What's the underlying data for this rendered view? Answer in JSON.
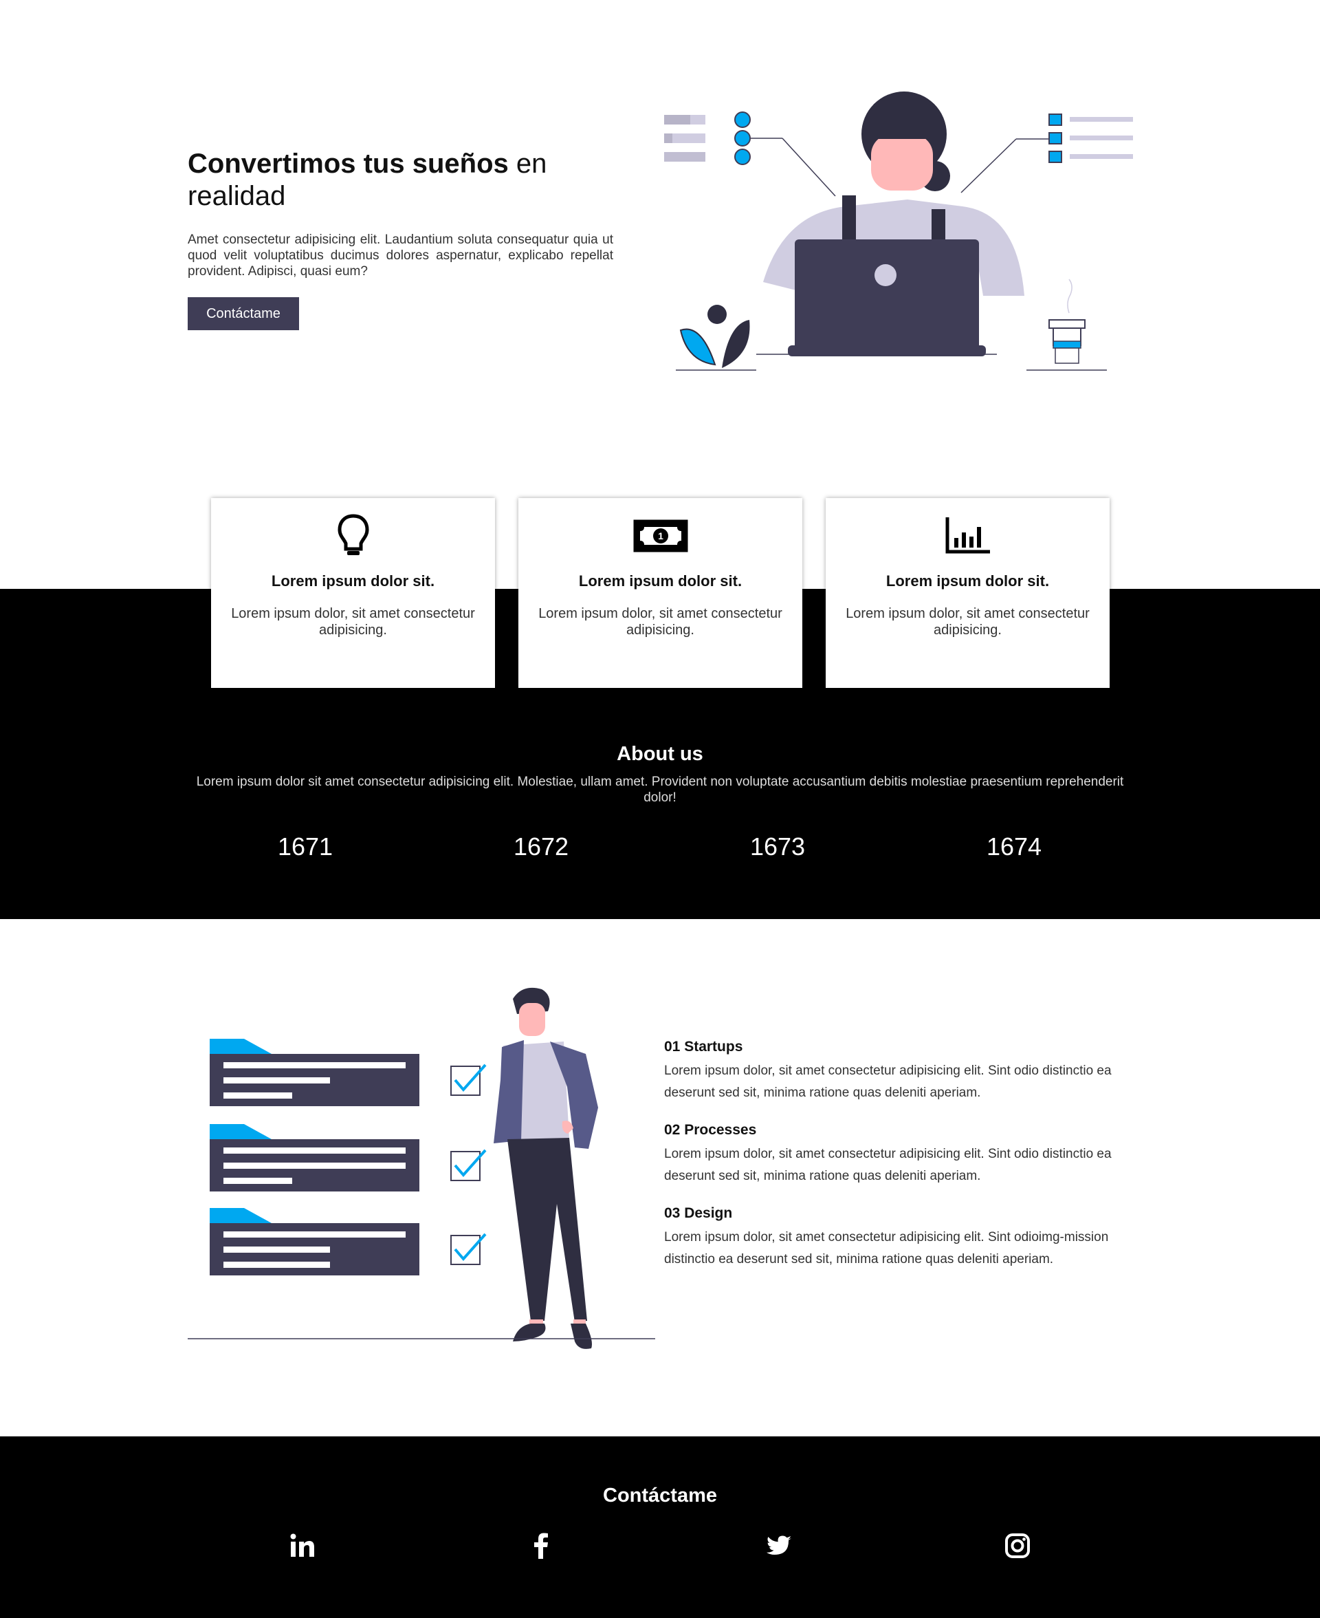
{
  "hero": {
    "title_bold": "Convertimos tus sueños",
    "title_rest": " en realidad",
    "description": "Amet consectetur adipisicing elit. Laudantium soluta consequatur quia ut quod velit voluptatibus ducimus dolores aspernatur, explicabo repellat provident. Adipisci, quasi eum?",
    "button_label": "Contáctame"
  },
  "features": [
    {
      "icon": "lightbulb-icon",
      "title": "Lorem ipsum dolor sit.",
      "text": "Lorem ipsum dolor, sit amet consectetur adipisicing."
    },
    {
      "icon": "money-bill-icon",
      "title": "Lorem ipsum dolor sit.",
      "text": "Lorem ipsum dolor, sit amet consectetur adipisicing."
    },
    {
      "icon": "bar-chart-icon",
      "title": "Lorem ipsum dolor sit.",
      "text": "Lorem ipsum dolor, sit amet consectetur adipisicing."
    }
  ],
  "about": {
    "title": "About us",
    "text": "Lorem ipsum dolor sit amet consectetur adipisicing elit. Molestiae, ullam amet. Provident non voluptate accusantium debitis molestiae praesentium reprehenderit dolor!",
    "stats": [
      "1671",
      "1672",
      "1673",
      "1674"
    ]
  },
  "services": [
    {
      "title": "01 Startups",
      "text": "Lorem ipsum dolor, sit amet consectetur adipisicing elit. Sint odio distinctio ea deserunt sed sit, minima ratione quas deleniti aperiam."
    },
    {
      "title": "02 Processes",
      "text": "Lorem ipsum dolor, sit amet consectetur adipisicing elit. Sint odio distinctio ea deserunt sed sit, minima ratione quas deleniti aperiam."
    },
    {
      "title": "03 Design",
      "text": "Lorem ipsum dolor, sit amet consectetur adipisicing elit. Sint odioimg-mission distinctio ea deserunt sed sit, minima ratione quas deleniti aperiam."
    }
  ],
  "footer": {
    "title": "Contáctame",
    "social": [
      "linkedin-icon",
      "facebook-icon",
      "twitter-icon",
      "instagram-icon"
    ]
  },
  "colors": {
    "accent": "#00a8f0",
    "dark": "#3f3d56",
    "black": "#000000",
    "skin": "#ffb8b8",
    "light_gray": "#d0cde1"
  }
}
